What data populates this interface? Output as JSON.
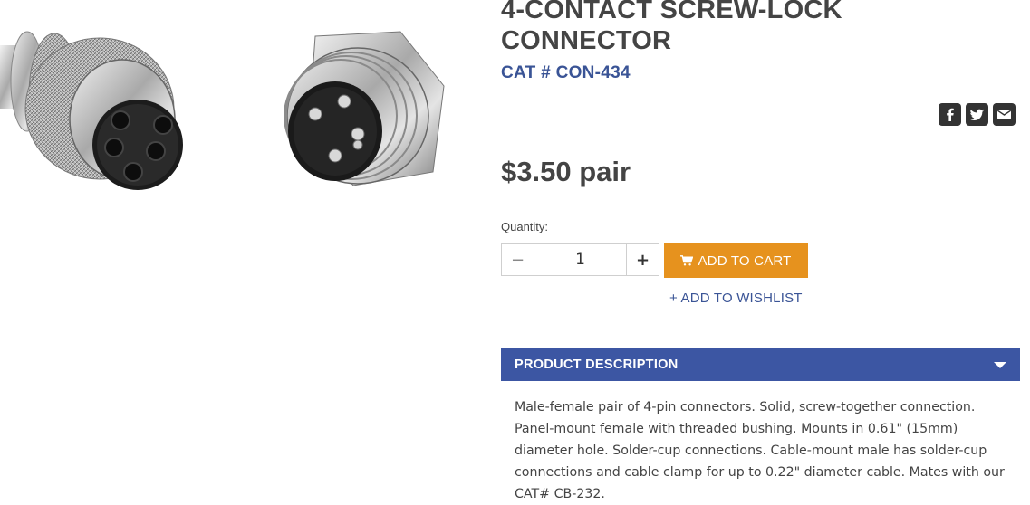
{
  "product": {
    "title": "4-CONTACT SCREW-LOCK CONNECTOR",
    "cat_number": "CAT # CON-434",
    "price": "$3.50 pair",
    "quantity_label": "Quantity:",
    "quantity_value": "1",
    "decrement_symbol": "−",
    "increment_symbol": "+",
    "add_to_cart_label": "ADD TO CART",
    "wishlist_label": "+ ADD TO WISHLIST"
  },
  "share": {
    "icons": [
      "facebook-icon",
      "twitter-icon",
      "email-icon"
    ]
  },
  "description": {
    "header": "PRODUCT DESCRIPTION",
    "text": "Male-female pair of 4-pin connectors. Solid, screw-together connection. Panel-mount female with threaded bushing. Mounts in 0.61\" (15mm) diameter hole. Solder-cup connections. Cable-mount male has solder-cup connections and cable clamp for up to 0.22\" diameter cable. Mates with our CAT# CB-232."
  },
  "colors": {
    "accent_blue": "#3c56a3",
    "link_blue": "#3a5496",
    "cart_orange": "#e6921e",
    "text_dark": "#444444"
  }
}
